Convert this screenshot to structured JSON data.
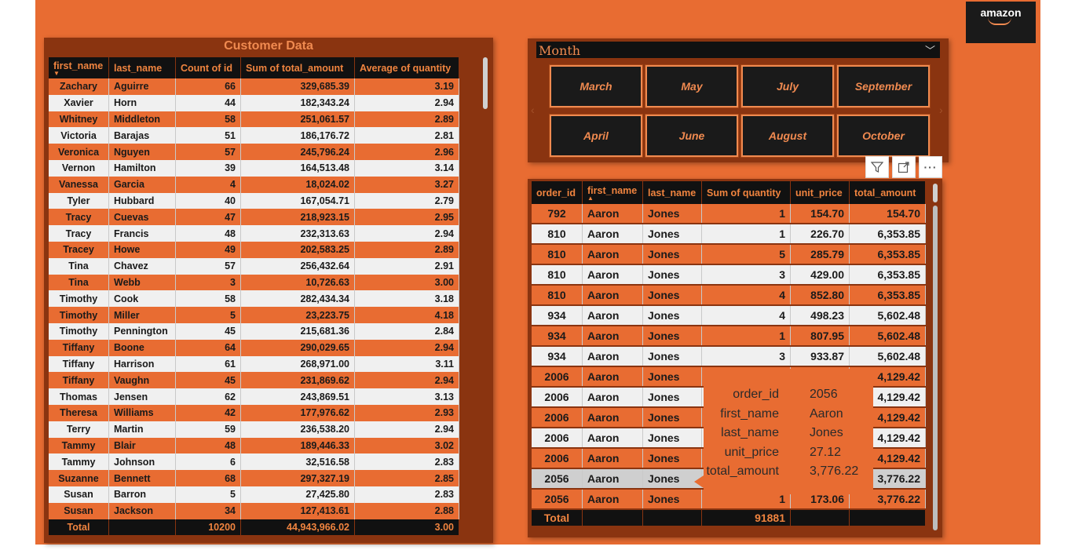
{
  "customer_table": {
    "title": "Customer Data",
    "columns": [
      "first_name",
      "last_name",
      "Count of id",
      "Sum of total_amount",
      "Average of quantity"
    ],
    "rows": [
      [
        "Zachary",
        "Aguirre",
        "66",
        "329,685.39",
        "3.19"
      ],
      [
        "Xavier",
        "Horn",
        "44",
        "182,343.24",
        "2.94"
      ],
      [
        "Whitney",
        "Middleton",
        "58",
        "251,061.57",
        "2.89"
      ],
      [
        "Victoria",
        "Barajas",
        "51",
        "186,176.72",
        "2.81"
      ],
      [
        "Veronica",
        "Nguyen",
        "57",
        "245,796.24",
        "2.96"
      ],
      [
        "Vernon",
        "Hamilton",
        "39",
        "164,513.48",
        "3.14"
      ],
      [
        "Vanessa",
        "Garcia",
        "4",
        "18,024.02",
        "3.27"
      ],
      [
        "Tyler",
        "Hubbard",
        "40",
        "167,054.71",
        "2.79"
      ],
      [
        "Tracy",
        "Cuevas",
        "47",
        "218,923.15",
        "2.95"
      ],
      [
        "Tracy",
        "Francis",
        "48",
        "232,313.63",
        "2.94"
      ],
      [
        "Tracey",
        "Howe",
        "49",
        "202,583.25",
        "2.89"
      ],
      [
        "Tina",
        "Chavez",
        "57",
        "256,432.64",
        "2.91"
      ],
      [
        "Tina",
        "Webb",
        "3",
        "10,726.63",
        "3.00"
      ],
      [
        "Timothy",
        "Cook",
        "58",
        "282,434.34",
        "3.18"
      ],
      [
        "Timothy",
        "Miller",
        "5",
        "23,223.75",
        "4.18"
      ],
      [
        "Timothy",
        "Pennington",
        "45",
        "215,681.36",
        "2.84"
      ],
      [
        "Tiffany",
        "Boone",
        "64",
        "290,029.65",
        "2.94"
      ],
      [
        "Tiffany",
        "Harrison",
        "61",
        "268,971.00",
        "3.11"
      ],
      [
        "Tiffany",
        "Vaughn",
        "45",
        "231,869.62",
        "2.94"
      ],
      [
        "Thomas",
        "Jensen",
        "62",
        "243,869.51",
        "3.13"
      ],
      [
        "Theresa",
        "Williams",
        "42",
        "177,976.62",
        "2.93"
      ],
      [
        "Terry",
        "Martin",
        "59",
        "236,538.20",
        "2.94"
      ],
      [
        "Tammy",
        "Blair",
        "48",
        "189,446.33",
        "3.02"
      ],
      [
        "Tammy",
        "Johnson",
        "6",
        "32,516.58",
        "2.83"
      ],
      [
        "Suzanne",
        "Bennett",
        "68",
        "297,327.19",
        "2.85"
      ],
      [
        "Susan",
        "Barron",
        "5",
        "27,425.80",
        "2.83"
      ],
      [
        "Susan",
        "Jackson",
        "34",
        "127,413.61",
        "2.88"
      ]
    ],
    "total": [
      "Total",
      "",
      "10200",
      "44,943,966.02",
      "3.00"
    ]
  },
  "month_slicer": {
    "label": "Month",
    "buttons": [
      "March",
      "May",
      "July",
      "September",
      "April",
      "June",
      "August",
      "October"
    ]
  },
  "logo": {
    "text": "amazon"
  },
  "visual_header": {
    "icons": [
      "filter-icon",
      "focus-mode-icon",
      "more-options-icon"
    ],
    "more_glyph": "···"
  },
  "orders_table": {
    "columns": [
      "order_id",
      "first_name",
      "last_name",
      "Sum of quantity",
      "unit_price",
      "total_amount"
    ],
    "rows": [
      [
        "792",
        "Aaron",
        "Jones",
        "1",
        "154.70",
        "154.70"
      ],
      [
        "810",
        "Aaron",
        "Jones",
        "1",
        "226.70",
        "6,353.85"
      ],
      [
        "810",
        "Aaron",
        "Jones",
        "5",
        "285.79",
        "6,353.85"
      ],
      [
        "810",
        "Aaron",
        "Jones",
        "3",
        "429.00",
        "6,353.85"
      ],
      [
        "810",
        "Aaron",
        "Jones",
        "4",
        "852.80",
        "6,353.85"
      ],
      [
        "934",
        "Aaron",
        "Jones",
        "4",
        "498.23",
        "5,602.48"
      ],
      [
        "934",
        "Aaron",
        "Jones",
        "1",
        "807.95",
        "5,602.48"
      ],
      [
        "934",
        "Aaron",
        "Jones",
        "3",
        "933.87",
        "5,602.48"
      ],
      [
        "2006",
        "Aaron",
        "Jones",
        "",
        "",
        "4,129.42"
      ],
      [
        "2006",
        "Aaron",
        "Jones",
        "",
        "",
        "4,129.42"
      ],
      [
        "2006",
        "Aaron",
        "Jones",
        "",
        "",
        "4,129.42"
      ],
      [
        "2006",
        "Aaron",
        "Jones",
        "",
        "",
        "4,129.42"
      ],
      [
        "2006",
        "Aaron",
        "Jones",
        "",
        "",
        "4,129.42"
      ],
      [
        "2056",
        "Aaron",
        "Jones",
        "",
        "",
        "3,776.22"
      ],
      [
        "2056",
        "Aaron",
        "Jones",
        "1",
        "173.06",
        "3,776.22"
      ]
    ],
    "total": [
      "Total",
      "",
      "",
      "91881",
      "",
      ""
    ]
  },
  "tooltip": [
    {
      "key": "order_id",
      "value": "2056"
    },
    {
      "key": "first_name",
      "value": "Aaron"
    },
    {
      "key": "last_name",
      "value": "Jones"
    },
    {
      "key": "unit_price",
      "value": "27.12"
    },
    {
      "key": "total_amount",
      "value": "3,776.22"
    }
  ],
  "colors": {
    "accent": "#e86c32",
    "dark": "#111111",
    "panel": "#8a3410",
    "header_text": "#f0843f"
  }
}
